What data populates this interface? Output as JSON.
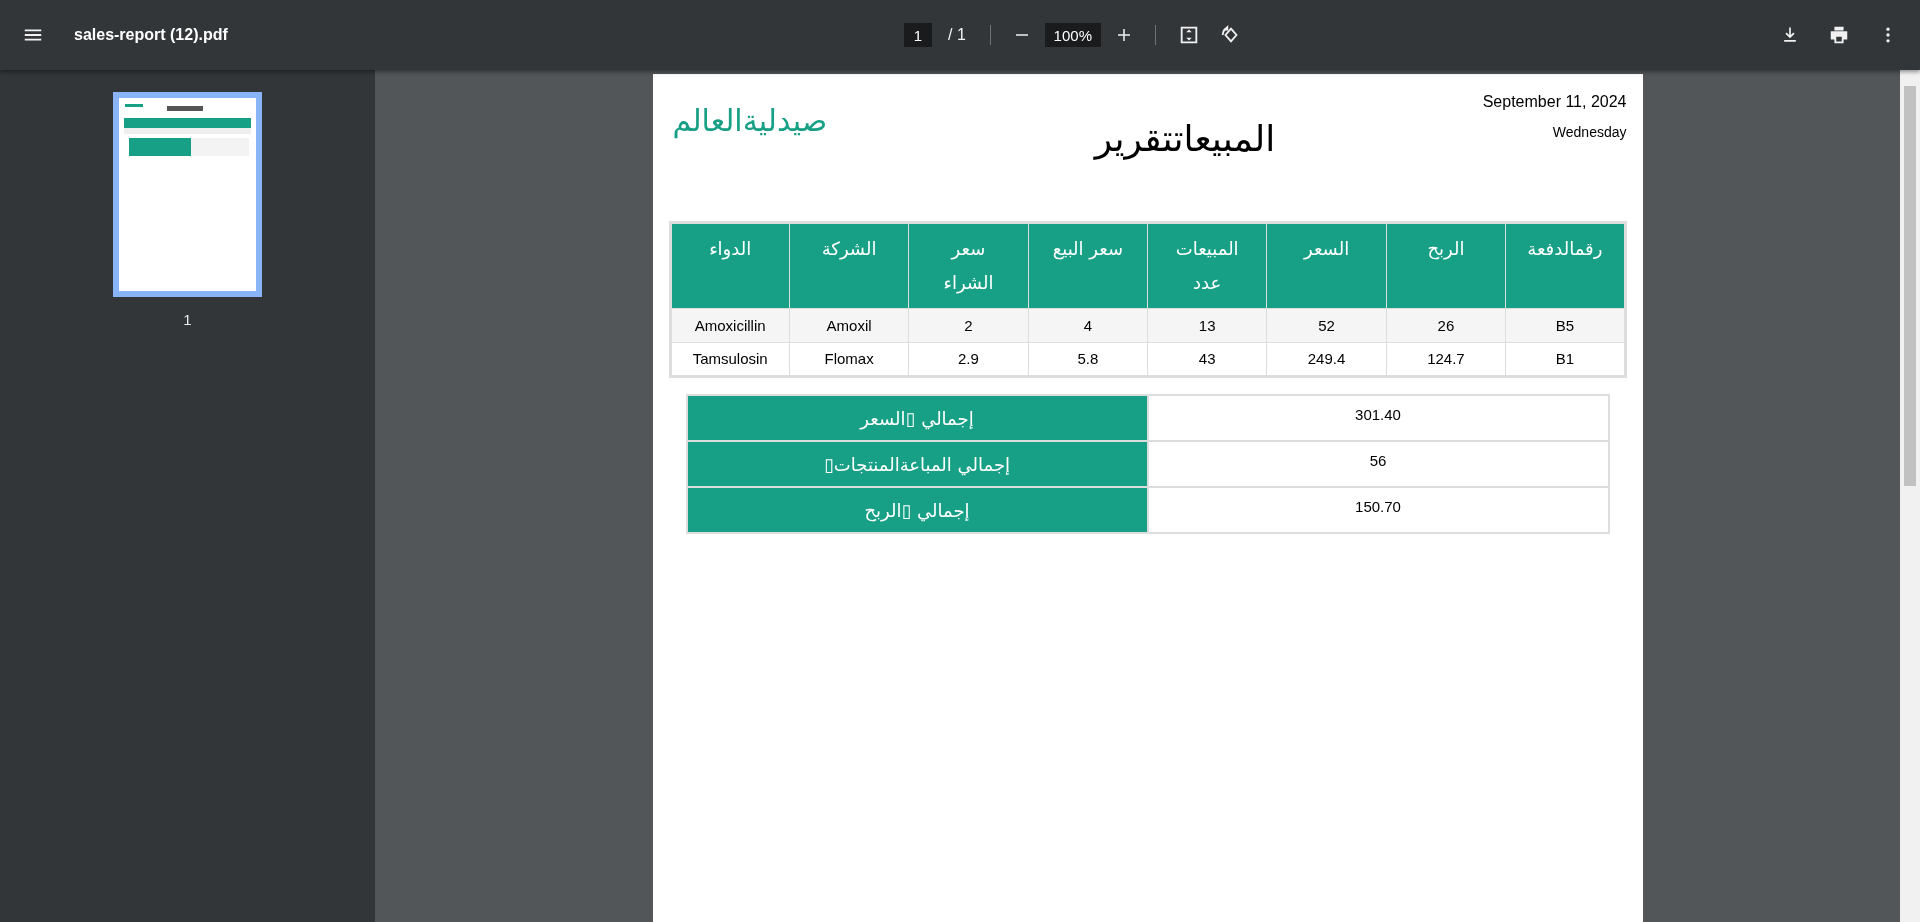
{
  "toolbar": {
    "title": "sales-report (12).pdf",
    "page_input": "1",
    "page_total": "/ 1",
    "zoom_input": "100%"
  },
  "sidebar": {
    "thumbnails": [
      {
        "label": "1",
        "selected": true
      }
    ]
  },
  "document": {
    "logo": "صيدليةالعالم",
    "date": "September 11, 2024",
    "weekday": "Wednesday",
    "title": "المبيعاتتقرير",
    "table": {
      "columns": [
        "رقمالدفعة",
        "الربح",
        "السعر",
        "المبيعات عدد",
        "سعر البيع",
        "سعر الشراء",
        "الشركة",
        "الدواء"
      ],
      "rows": [
        [
          "B5",
          "26",
          "52",
          "13",
          "4",
          "2",
          "Amoxil",
          "Amoxicillin"
        ],
        [
          "B1",
          "124.7",
          "249.4",
          "43",
          "5.8",
          "2.9",
          "Flomax",
          "Tamsulosin"
        ]
      ]
    },
    "totals": [
      {
        "label": "إجمالي  ▯السعر",
        "value": "301.40"
      },
      {
        "label": "▯إجمالي  المباعةالمنتجات",
        "value": "56"
      },
      {
        "label": "إجمالي  ▯الربح",
        "value": "150.70"
      }
    ]
  }
}
